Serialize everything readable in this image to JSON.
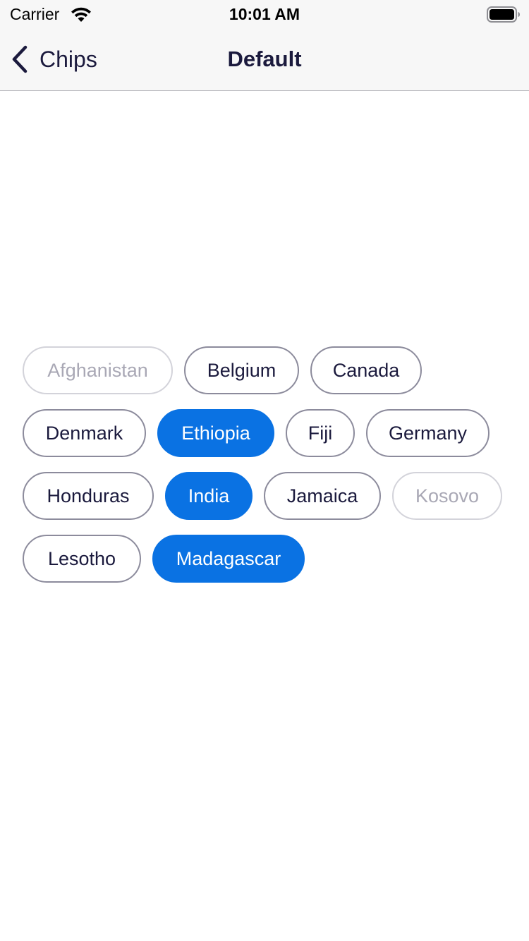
{
  "status_bar": {
    "carrier": "Carrier",
    "time": "10:01 AM",
    "wifi_icon": "wifi-icon",
    "battery_icon": "battery-icon"
  },
  "nav": {
    "back_label": "Chips",
    "title": "Default",
    "back_icon": "chevron-left-icon"
  },
  "colors": {
    "accent": "#0a72e3",
    "text": "#1b1a3d",
    "chip_border": "#8c8b9c",
    "disabled_border": "#d3d3da",
    "disabled_text": "#a9a8b5"
  },
  "chips": [
    {
      "label": "Afghanistan",
      "state": "disabled"
    },
    {
      "label": "Belgium",
      "state": "default"
    },
    {
      "label": "Canada",
      "state": "default"
    },
    {
      "label": "Denmark",
      "state": "default"
    },
    {
      "label": "Ethiopia",
      "state": "selected"
    },
    {
      "label": "Fiji",
      "state": "default"
    },
    {
      "label": "Germany",
      "state": "default"
    },
    {
      "label": "Honduras",
      "state": "default"
    },
    {
      "label": "India",
      "state": "selected"
    },
    {
      "label": "Jamaica",
      "state": "default"
    },
    {
      "label": "Kosovo",
      "state": "disabled"
    },
    {
      "label": "Lesotho",
      "state": "default"
    },
    {
      "label": "Madagascar",
      "state": "selected"
    }
  ]
}
